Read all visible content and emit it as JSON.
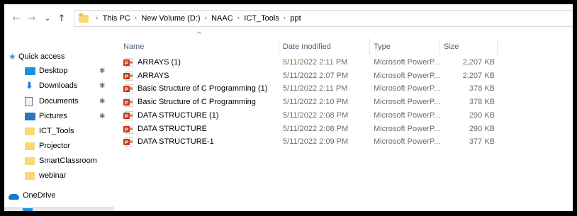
{
  "nav": {
    "back_glyph": "←",
    "forward_glyph": "→",
    "recent_glyph": "⌄",
    "up_glyph": "↑"
  },
  "address": {
    "crumbs": [
      "This PC",
      "New Volume (D:)",
      "NAAC",
      "ICT_Tools",
      "ppt"
    ],
    "separator": "›"
  },
  "sidebar": {
    "quick_access": "Quick access",
    "items": [
      {
        "label": "Desktop",
        "icon": "desktop-icon",
        "pinned": true
      },
      {
        "label": "Downloads",
        "icon": "download-icon",
        "pinned": true
      },
      {
        "label": "Documents",
        "icon": "documents-icon",
        "pinned": true
      },
      {
        "label": "Pictures",
        "icon": "pictures-icon",
        "pinned": true
      },
      {
        "label": "ICT_Tools",
        "icon": "folder-icon",
        "pinned": false
      },
      {
        "label": "Projector",
        "icon": "folder-icon",
        "pinned": false
      },
      {
        "label": "SmartClassroom",
        "icon": "folder-icon",
        "pinned": false
      },
      {
        "label": "webinar",
        "icon": "folder-icon",
        "pinned": false
      }
    ],
    "onedrive": "OneDrive",
    "pin_glyph": "📌"
  },
  "columns": {
    "name": "Name",
    "date": "Date modified",
    "type": "Type",
    "size": "Size",
    "sort_glyph": "^"
  },
  "files": [
    {
      "name": "ARRAYS (1)",
      "date": "5/11/2022 2:11 PM",
      "type": "Microsoft PowerP...",
      "size": "2,207 KB"
    },
    {
      "name": "ARRAYS",
      "date": "5/11/2022 2:07 PM",
      "type": "Microsoft PowerP...",
      "size": "2,207 KB"
    },
    {
      "name": "Basic Structure of C Programming (1)",
      "date": "5/11/2022 2:11 PM",
      "type": "Microsoft PowerP...",
      "size": "378 KB"
    },
    {
      "name": "Basic Structure of C Programming",
      "date": "5/11/2022 2:10 PM",
      "type": "Microsoft PowerP...",
      "size": "378 KB"
    },
    {
      "name": "DATA STRUCTURE (1)",
      "date": "5/11/2022 2:08 PM",
      "type": "Microsoft PowerP...",
      "size": "290 KB"
    },
    {
      "name": "DATA STRUCTURE",
      "date": "5/11/2022 2:08 PM",
      "type": "Microsoft PowerP...",
      "size": "290 KB"
    },
    {
      "name": "DATA STRUCTURE-1",
      "date": "5/11/2022 2:09 PM",
      "type": "Microsoft PowerP...",
      "size": "377 KB"
    }
  ],
  "colors": {
    "folder": "#f8d775",
    "ppt": "#c43e1c",
    "accent": "#1e90e0"
  }
}
